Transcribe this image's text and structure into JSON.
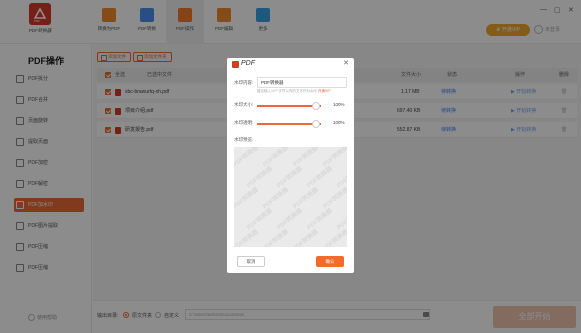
{
  "app": {
    "logo_badge": "PDF",
    "logo_text": "PDF转换器",
    "vip_label": "开通VIP",
    "login_label": "未登录"
  },
  "nav": [
    {
      "label": "转换为PDF",
      "icon": "convert-to-pdf-icon",
      "color": "#f08a2c"
    },
    {
      "label": "PDF转换",
      "icon": "pdf-convert-icon",
      "color": "#4a8ff0"
    },
    {
      "label": "PDF操作",
      "icon": "pdf-operate-icon",
      "color": "#f07a2c"
    },
    {
      "label": "PDF编辑",
      "icon": "pdf-edit-icon",
      "color": "#f08a2c"
    },
    {
      "label": "更多",
      "icon": "more-grid-icon",
      "color": "#3aa0e8"
    }
  ],
  "sidebar": {
    "title": "PDF操作",
    "items": [
      {
        "label": "PDF拆分"
      },
      {
        "label": "PDF合并"
      },
      {
        "label": "页面旋转"
      },
      {
        "label": "提取页面"
      },
      {
        "label": "PDF加密"
      },
      {
        "label": "PDF解密"
      },
      {
        "label": "PDF加水印"
      },
      {
        "label": "PDF图片提取"
      },
      {
        "label": "PDF压缩"
      },
      {
        "label": "PDF压缩"
      }
    ],
    "help": "使用帮助"
  },
  "toolbar": {
    "add_file": "添加文件",
    "add_folder": "添加文件夹"
  },
  "table": {
    "headers": [
      "全选",
      "已选中文件",
      "文件大小",
      "状态",
      "操作",
      "删除"
    ],
    "rows": [
      {
        "name": "xbc-brawurtq-xh.pdf",
        "size": "1.17 MB",
        "status": "待转换",
        "action": "开始转换"
      },
      {
        "name": "项目介绍.pdf",
        "size": "697.40 KB",
        "status": "待转换",
        "action": "开始转换"
      },
      {
        "name": "研发报告.pdf",
        "size": "552.87 KB",
        "status": "待转换",
        "action": "开始转换"
      }
    ]
  },
  "bottom": {
    "output_label": "输出目录:",
    "option_original": "原文件夹",
    "option_custom": "自定义",
    "path": "C:\\Users\\admin\\Documents",
    "start": "全部开始"
  },
  "dialog": {
    "title": "PDF",
    "content_label": "水印内容:",
    "content_value": "PDF转换器",
    "hint": "建议输入10个字符以内的文字作为水印",
    "hint_link": "开通VIP",
    "size_label": "水印大小:",
    "size_value": "100%",
    "size_fraction": 0.92,
    "opacity_label": "水印透明:",
    "opacity_value": "100%",
    "opacity_fraction": 0.92,
    "preview_label": "水印预览:",
    "watermark_text": "PDF转换器",
    "cancel": "取消",
    "ok": "确认"
  }
}
